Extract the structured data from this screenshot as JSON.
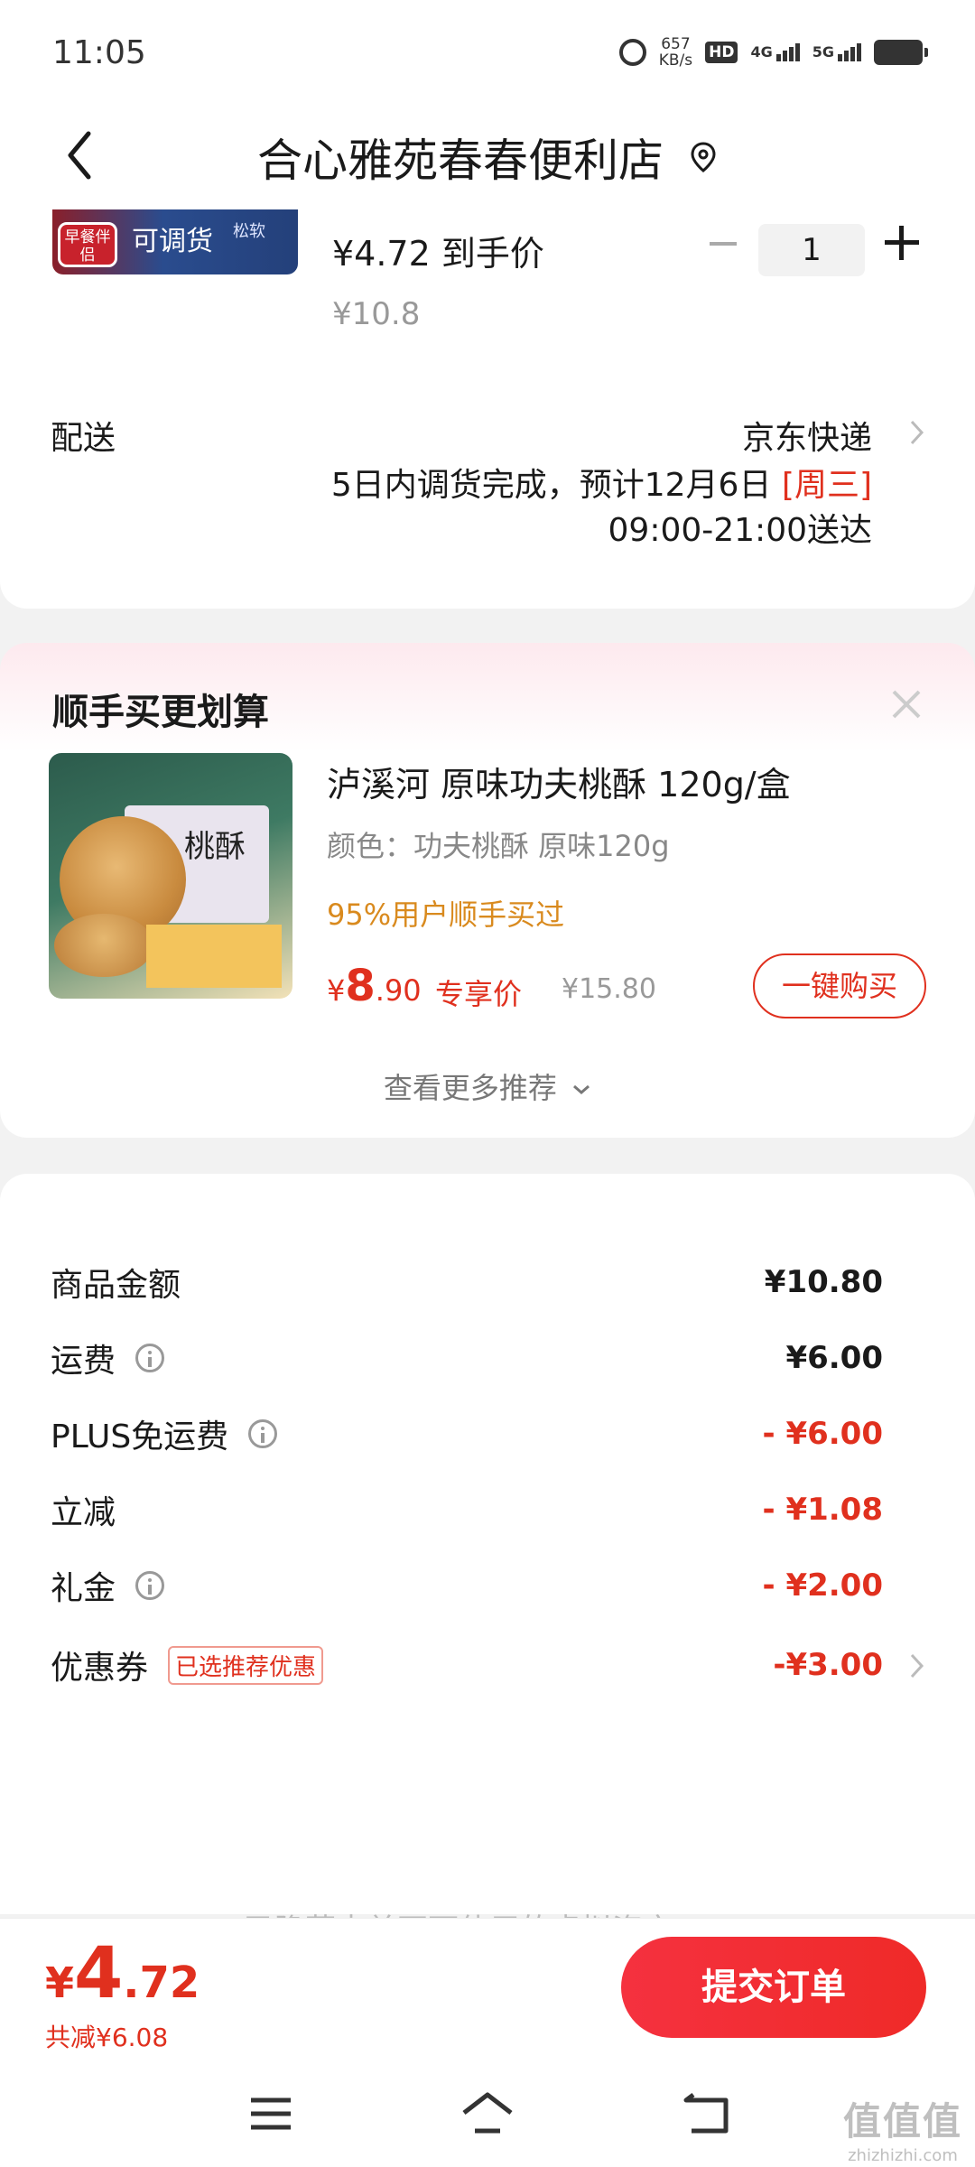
{
  "status_bar": {
    "time": "11:05",
    "speed_value": "657",
    "speed_unit": "KB/s",
    "hd_label": "HD",
    "net1_label": "4G",
    "net2_label": "5G"
  },
  "header": {
    "store_name": "合心雅苑春春便利店"
  },
  "product": {
    "thumb_badge": "早餐伴侣",
    "thumb_text": "可调货",
    "thumb_text2": "松软",
    "deal_price": "¥4.72 到手价",
    "original_price": "¥10.8",
    "quantity": "1"
  },
  "delivery": {
    "label": "配送",
    "method": "京东快递",
    "estimate": "5日内调货完成，预计12月6日 ",
    "weekday": "[周三]",
    "time_window": "09:00-21:00送达"
  },
  "recommend": {
    "title": "顺手买更划算",
    "item": {
      "name": "泸溪河 原味功夫桃酥 120g/盒",
      "variant": "颜色：功夫桃酥 原味120g",
      "promo": "95%用户顺手买过",
      "price_currency": "¥",
      "price_int": "8",
      "price_dec": ".90",
      "member_label": "专享价",
      "original_price": "¥15.80",
      "buy_label": "一键购买",
      "box_text": "桃酥"
    },
    "more_label": "查看更多推荐"
  },
  "summary": {
    "rows": [
      {
        "label": "商品金额",
        "value": "¥10.80"
      },
      {
        "label": "运费",
        "value": "¥6.00"
      },
      {
        "label": "PLUS免运费",
        "value": "- ¥6.00"
      },
      {
        "label": "立减",
        "value": "- ¥1.08"
      },
      {
        "label": "礼金",
        "value": "- ¥2.00"
      },
      {
        "label": "优惠券",
        "value": "-¥3.00",
        "tag": "已选推荐优惠"
      }
    ],
    "fade_text": "已隐藏本单不可使用的虚拟资产"
  },
  "bottom": {
    "total_currency": "¥",
    "total_int": "4",
    "total_dec": ".72",
    "saved": "共减¥6.08",
    "submit_label": "提交订单"
  },
  "watermark": {
    "logo": "值值值",
    "url": "zhizhizhi.com"
  },
  "colors": {
    "accent_red": "#e0301e",
    "promo_orange": "#d98a1e"
  }
}
